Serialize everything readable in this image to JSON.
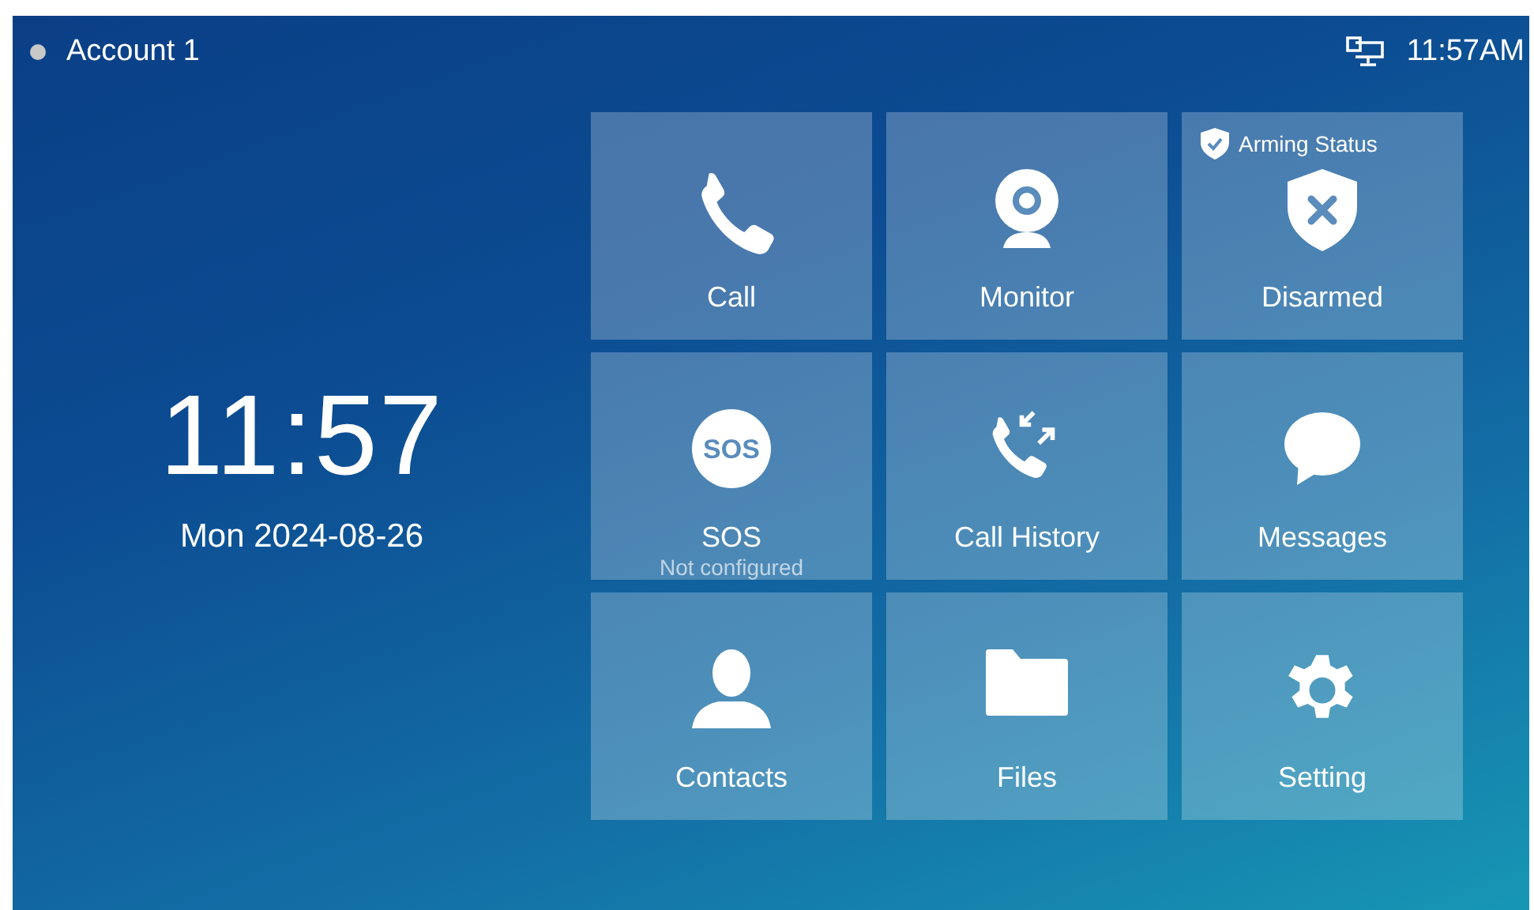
{
  "status_bar": {
    "account": {
      "name": "Account 1",
      "registered": false
    },
    "time": "11:57AM"
  },
  "clock": {
    "time": "11:57",
    "date": "Mon 2024-08-26"
  },
  "tiles": [
    {
      "kind": "app",
      "label": "Call"
    },
    {
      "kind": "app",
      "label": "Monitor"
    },
    {
      "kind": "status",
      "badge": "Arming Status",
      "label": "Disarmed"
    },
    {
      "kind": "app",
      "icon_text": "SOS",
      "label": "SOS",
      "note": "Not configured"
    },
    {
      "kind": "app",
      "label": "Call History"
    },
    {
      "kind": "app",
      "label": "Messages"
    },
    {
      "kind": "app",
      "label": "Contacts"
    },
    {
      "kind": "app",
      "label": "Files"
    },
    {
      "kind": "app",
      "label": "Setting"
    }
  ]
}
